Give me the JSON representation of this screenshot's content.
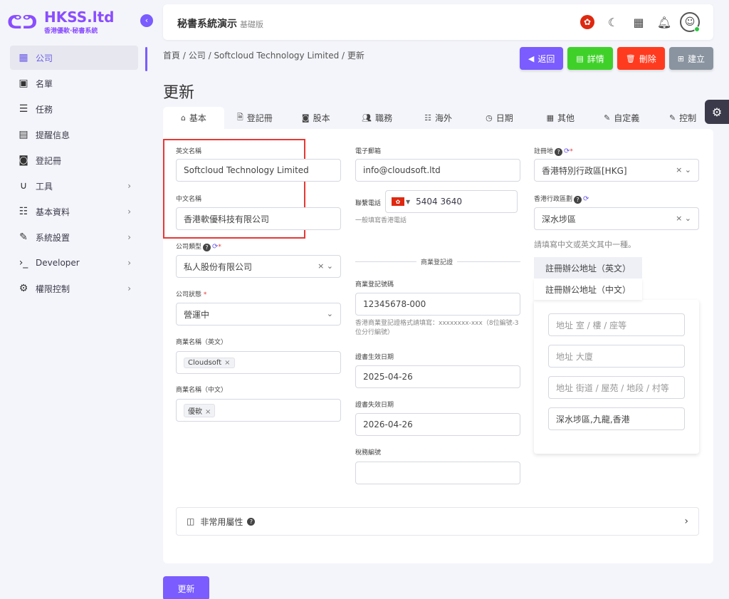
{
  "brand": {
    "title": "HKSS.ltd",
    "subtitle": "香港優軟·秘書系統",
    "accent": "#7a5cff"
  },
  "sidebar": {
    "items": [
      {
        "label": "公司",
        "icon": "building-icon"
      },
      {
        "label": "名單",
        "icon": "contact-card-icon"
      },
      {
        "label": "任務",
        "icon": "checklist-icon"
      },
      {
        "label": "提醒信息",
        "icon": "calendar-check-icon"
      },
      {
        "label": "登記冊",
        "icon": "register-book-icon"
      },
      {
        "label": "工具",
        "icon": "magnet-icon"
      },
      {
        "label": "基本資料",
        "icon": "database-icon"
      },
      {
        "label": "系統設置",
        "icon": "wrench-icon"
      },
      {
        "label": "Developer",
        "icon": "terminal-icon"
      },
      {
        "label": "權限控制",
        "icon": "gears-icon"
      }
    ]
  },
  "header": {
    "title": "秘書系統演示",
    "edition": "基礎版"
  },
  "breadcrumb": {
    "home": "首頁",
    "sep": "/",
    "company": "公司",
    "record": "Softcloud Technology Limited",
    "current": "更新"
  },
  "actions": {
    "back": {
      "label": "返回",
      "color": "#7a5cff"
    },
    "details": {
      "label": "詳情",
      "color": "#3fd12a"
    },
    "delete": {
      "label": "刪除",
      "color": "#ff3b1f"
    },
    "create": {
      "label": "建立",
      "color": "#8a94a0"
    }
  },
  "page_title": "更新",
  "tabs": [
    "基本",
    "登記冊",
    "股本",
    "職務",
    "海外",
    "日期",
    "其他",
    "自定義",
    "控制"
  ],
  "form": {
    "english_name": {
      "label": "英文名稱",
      "value": "Softcloud Technology Limited"
    },
    "chinese_name": {
      "label": "中文名稱",
      "value": "香港軟優科技有限公司"
    },
    "company_type": {
      "label": "公司類型",
      "value": "私人股份有限公司"
    },
    "company_status": {
      "label": "公司狀態",
      "value": "營運中"
    },
    "business_name_en": {
      "label": "商業名稱（英文）",
      "chip": "Cloudsoft"
    },
    "business_name_zh": {
      "label": "商業名稱（中文）",
      "chip": "優軟"
    },
    "email": {
      "label": "電子郵箱",
      "value": "info@cloudsoft.ltd"
    },
    "phone": {
      "label": "聯繫電話",
      "value": "5404 3640",
      "hint": "一般填寫香港電話"
    },
    "br_section": "商業登記證",
    "br_number": {
      "label": "商業登記號碼",
      "value": "12345678-000",
      "hint": "香港商業登記證格式請填寫：xxxxxxxx-xxx（8位編號-3位分行編號）"
    },
    "cert_start": {
      "label": "證書生效日期",
      "value": "2025-04-26"
    },
    "cert_end": {
      "label": "證書失效日期",
      "value": "2026-04-26"
    },
    "tax_number": {
      "label": "稅務編號",
      "value": ""
    },
    "reg_place": {
      "label": "註冊地",
      "value": "香港特別行政區[HKG]"
    },
    "district": {
      "label": "香港行政區劃",
      "value": "深水埗區"
    },
    "address_hint": "請填寫中文或英文其中一種。",
    "address_tabs": [
      "註冊辦公地址（英文）",
      "註冊辦公地址（中文）"
    ],
    "address_room_placeholder": "地址 室 / 樓 / 座等",
    "address_building_placeholder": "地址 大廈",
    "address_street_placeholder": "地址 街道 / 屋苑 / 地段 / 村等",
    "address_area_value": "深水埗區,九龍,香港",
    "uncommon_attrs": "非常用屬性"
  },
  "submit_label": "更新"
}
